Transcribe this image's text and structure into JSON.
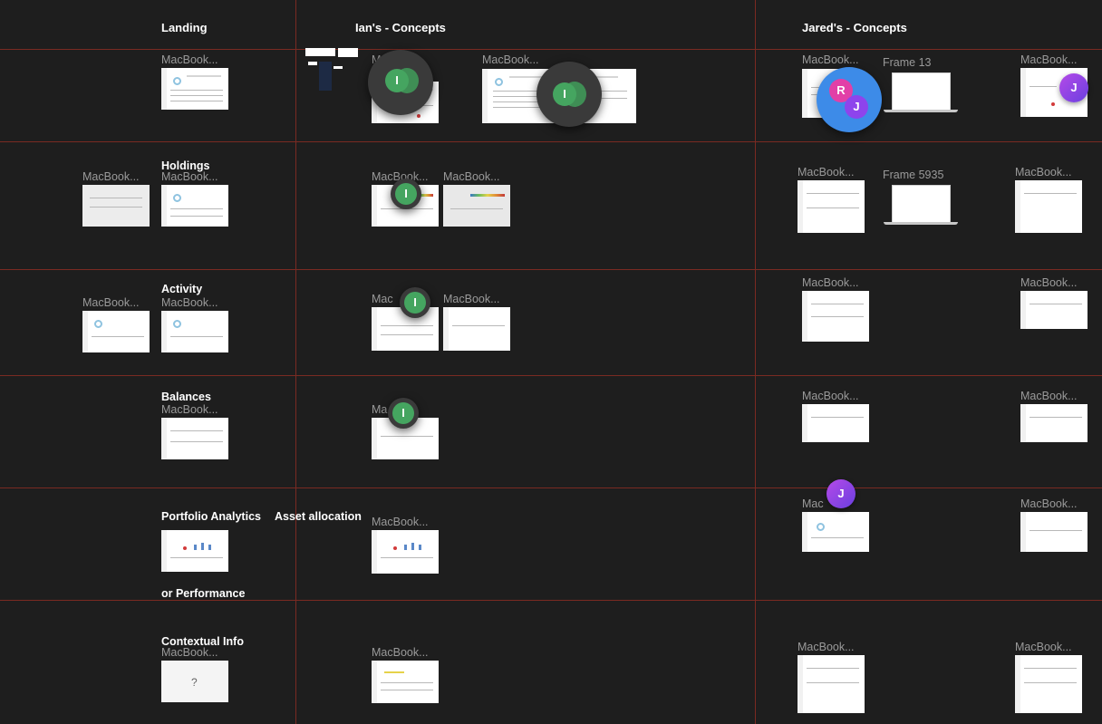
{
  "columns": {
    "landing": "Landing",
    "ians": "Ian's - Concepts",
    "jareds": "Jared's - Concepts"
  },
  "rows": {
    "holdings": "Holdings",
    "activity": "Activity",
    "balances": "Balances",
    "portfolio_analytics": "Portfolio Analytics",
    "asset_allocation": "Asset allocation",
    "or_performance": "or Performance",
    "contextual_info": "Contextual Info"
  },
  "frame_names": {
    "macbook": "MacBook...",
    "macbook_short1": "MacBook...",
    "macbook_short2": "Ma",
    "macbook_short3": "Mac",
    "frame13": "Frame 13",
    "frame5935": "Frame 5935"
  },
  "placeholder_glyph": "?",
  "collaborators": {
    "ian": "I",
    "r": "R",
    "jared": "J"
  },
  "colors": {
    "canvas_bg": "#1e1e1e",
    "grid_line": "#7a2a22",
    "ian_avatar": "#45a560",
    "jared_avatar": "#8e44ec",
    "r_avatar": "#e23fa7",
    "cursor_ring": "#3d8be8"
  }
}
